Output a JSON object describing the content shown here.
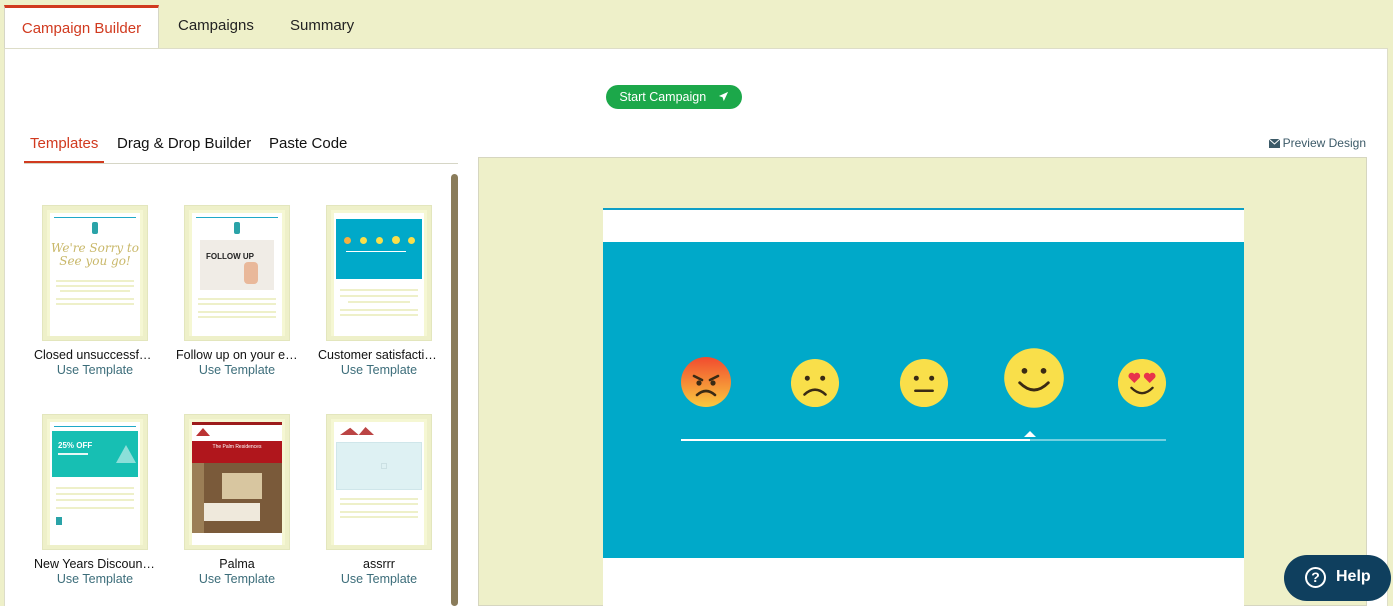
{
  "top_tabs": [
    "Campaign Builder",
    "Campaigns",
    "Summary"
  ],
  "start_button": "Start Campaign",
  "sub_tabs": [
    "Templates",
    "Drag & Drop Builder",
    "Paste Code"
  ],
  "preview_link": "Preview Design",
  "use_template_label": "Use Template",
  "templates": [
    {
      "name": "Closed unsuccessful...",
      "thumb_text": "We're Sorry to See you go!"
    },
    {
      "name": "Follow up on your en...",
      "thumb_text": "FOLLOW UP"
    },
    {
      "name": "Customer satisfactio...",
      "thumb_text": ""
    },
    {
      "name": "New Years Discount ...",
      "thumb_text": "25% OFF"
    },
    {
      "name": "Palma",
      "thumb_text": "The Palm Residences"
    },
    {
      "name": "assrrr",
      "thumb_text": ""
    }
  ],
  "rating": {
    "selected_index": 3,
    "count": 5,
    "level": 0.72
  },
  "emojis": [
    "angry-face",
    "frowning-face",
    "neutral-face",
    "smiling-face",
    "heart-eyes-face"
  ],
  "help_label": "Help",
  "colors": {
    "accent": "#d13a1f",
    "start": "#1ca84a",
    "band": "#00a9c9",
    "emoji": "#f9df4a",
    "help": "#0f3f5e",
    "page_bg": "#eef0c9"
  }
}
